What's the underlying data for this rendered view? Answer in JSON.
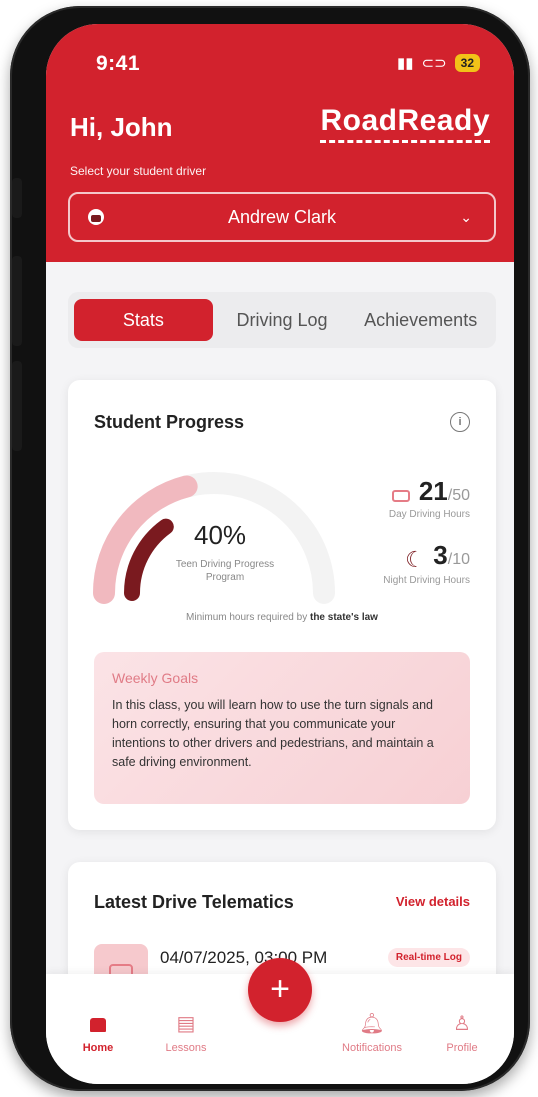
{
  "status_bar": {
    "time": "9:41",
    "battery": "32"
  },
  "header": {
    "greeting": "Hi, John",
    "logo": "RoadReady",
    "select_label": "Select your student driver",
    "selected_student": "Andrew Clark"
  },
  "tabs": [
    {
      "label": "Stats",
      "active": true
    },
    {
      "label": "Driving Log",
      "active": false
    },
    {
      "label": "Achievements",
      "active": false
    }
  ],
  "progress_card": {
    "title": "Student Progress",
    "percent": "40%",
    "percent_value": 40,
    "percent_sub": "Teen Driving Progress Program",
    "day": {
      "value": "21",
      "total": "/50",
      "label": "Day Driving Hours"
    },
    "night": {
      "value": "3",
      "total": "/10",
      "label": "Night Driving Hours"
    },
    "min_hours_text": "Minimum hours required by",
    "min_hours_bold": "the state's law"
  },
  "weekly_goals": {
    "title": "Weekly Goals",
    "text": "In this class, you will learn how to use the turn signals and horn correctly, ensuring that you communicate your intentions to other drivers and pedestrians, and maintain a safe driving environment."
  },
  "telematics": {
    "title": "Latest Drive Telematics",
    "view_details": "View details",
    "date": "04/07/2025, 03:00 PM",
    "badge": "Real-time Log"
  },
  "nav": [
    {
      "label": "Home",
      "icon": "home-icon",
      "active": true
    },
    {
      "label": "Lessons",
      "icon": "book-icon",
      "active": false
    },
    {
      "label": "+",
      "icon": "plus-icon",
      "active": false
    },
    {
      "label": "Notifications",
      "icon": "bell-icon",
      "active": false
    },
    {
      "label": "Profile",
      "icon": "user-icon",
      "active": false
    }
  ],
  "colors": {
    "brand": "#d2222d",
    "light_pink": "#f6c9cd",
    "dark_red": "#7a1a1f"
  }
}
